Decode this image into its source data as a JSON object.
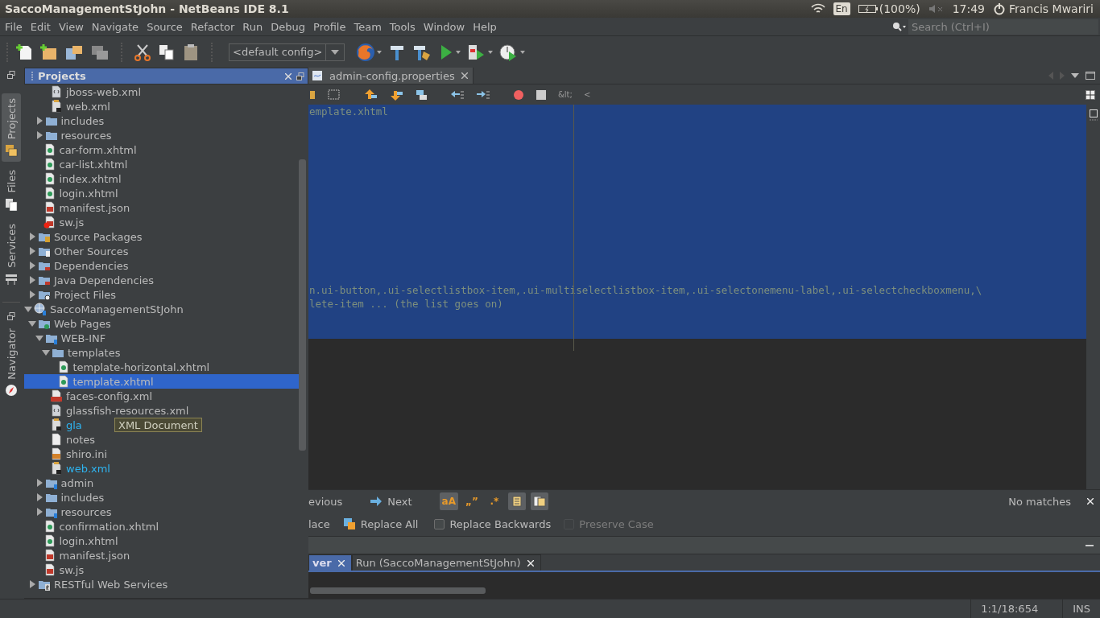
{
  "title_bar": {
    "title": "SaccoManagementStJohn - NetBeans IDE 8.1",
    "keyboard": "En",
    "battery": "(100%)",
    "time": "17:49",
    "user": "Francis Mwariri"
  },
  "menu": [
    "File",
    "Edit",
    "View",
    "Navigate",
    "Source",
    "Refactor",
    "Run",
    "Debug",
    "Profile",
    "Team",
    "Tools",
    "Window",
    "Help"
  ],
  "search": {
    "placeholder": "Search (Ctrl+I)"
  },
  "toolbar": {
    "config": "<default config>"
  },
  "side_tabs": [
    {
      "label": "Projects",
      "kind": "projects",
      "selected": true
    },
    {
      "label": "Files",
      "kind": "files",
      "selected": false
    },
    {
      "label": "Services",
      "kind": "services",
      "selected": false
    },
    {
      "label": "Navigator",
      "kind": "navigator",
      "selected": false
    }
  ],
  "projects_panel": {
    "title": "Projects",
    "tree": [
      {
        "children": [
          {
            "children": [
              {
                "children": [
                  {
                    "label": "jboss-web.xml",
                    "kind": "descriptor",
                    "selected": false,
                    "modified": false
                  },
                  {
                    "label": "web.xml",
                    "kind": "xml-doc",
                    "selected": false,
                    "modified": false
                  }
                ]
              },
              {
                "label": "includes",
                "kind": "folder",
                "expanded": false,
                "selected": false,
                "modified": false
              },
              {
                "label": "resources",
                "kind": "folder",
                "expanded": false,
                "selected": false,
                "modified": false
              },
              {
                "label": "car-form.xhtml",
                "kind": "xhtml",
                "selected": false,
                "modified": false
              },
              {
                "label": "car-list.xhtml",
                "kind": "xhtml",
                "selected": false,
                "modified": false
              },
              {
                "label": "index.xhtml",
                "kind": "xhtml",
                "selected": false,
                "modified": false
              },
              {
                "label": "login.xhtml",
                "kind": "xhtml",
                "selected": false,
                "modified": false
              },
              {
                "label": "manifest.json",
                "kind": "js",
                "selected": false,
                "modified": false
              },
              {
                "label": "sw.js",
                "kind": "js-error",
                "selected": false,
                "modified": false
              }
            ]
          },
          {
            "label": "Source Packages",
            "kind": "package-folder",
            "expanded": false,
            "selected": false,
            "modified": false
          },
          {
            "label": "Other Sources",
            "kind": "sources-folder",
            "expanded": false,
            "selected": false,
            "modified": false
          },
          {
            "label": "Dependencies",
            "kind": "lib-folder",
            "expanded": false,
            "selected": false,
            "modified": false
          },
          {
            "label": "Java Dependencies",
            "kind": "lib-folder",
            "expanded": false,
            "selected": false,
            "modified": false
          },
          {
            "label": "Project Files",
            "kind": "config-folder",
            "expanded": false,
            "selected": false,
            "modified": false
          }
        ]
      },
      {
        "label": "SaccoManagementStJohn",
        "kind": "web-project",
        "expanded": true,
        "selected": false,
        "modified": false,
        "children": [
          {
            "label": "Web Pages",
            "kind": "web-folder",
            "expanded": true,
            "selected": false,
            "modified": false,
            "children": [
              {
                "label": "WEB-INF",
                "kind": "folder-vcs",
                "expanded": true,
                "selected": false,
                "modified": false,
                "children": [
                  {
                    "label": "templates",
                    "kind": "folder",
                    "expanded": true,
                    "selected": false,
                    "modified": false,
                    "children": [
                      {
                        "label": "template-horizontal.xhtml",
                        "kind": "xhtml",
                        "selected": false,
                        "modified": false
                      },
                      {
                        "label": "template.xhtml",
                        "kind": "xhtml",
                        "selected": true,
                        "modified": false
                      }
                    ]
                  },
                  {
                    "label": "faces-config.xml",
                    "kind": "jsf",
                    "selected": false,
                    "modified": false
                  },
                  {
                    "label": "glassfish-resources.xml",
                    "kind": "descriptor",
                    "selected": false,
                    "modified": false
                  },
                  {
                    "label": "gla",
                    "kind": "xml-doc",
                    "selected": false,
                    "modified": true,
                    "tooltip": "XML Document"
                  },
                  {
                    "label": "notes",
                    "kind": "text",
                    "selected": false,
                    "modified": false
                  },
                  {
                    "label": "shiro.ini",
                    "kind": "ini",
                    "selected": false,
                    "modified": false
                  },
                  {
                    "label": "web.xml",
                    "kind": "xml-doc",
                    "selected": false,
                    "modified": true
                  }
                ]
              },
              {
                "label": "admin",
                "kind": "folder-vcs",
                "expanded": false,
                "selected": false,
                "modified": false
              },
              {
                "label": "includes",
                "kind": "folder",
                "expanded": false,
                "selected": false,
                "modified": false
              },
              {
                "label": "resources",
                "kind": "folder-vcs",
                "expanded": false,
                "selected": false,
                "modified": false
              },
              {
                "label": "confirmation.xhtml",
                "kind": "xhtml",
                "selected": false,
                "modified": false
              },
              {
                "label": "login.xhtml",
                "kind": "xhtml",
                "selected": false,
                "modified": false
              },
              {
                "label": "manifest.json",
                "kind": "js",
                "selected": false,
                "modified": false
              },
              {
                "label": "sw.js",
                "kind": "js",
                "selected": false,
                "modified": false
              }
            ]
          },
          {
            "label": "RESTful Web Services",
            "kind": "rest-folder",
            "expanded": false,
            "selected": false,
            "modified": false
          }
        ]
      }
    ]
  },
  "editor": {
    "tab": "admin-config.properties",
    "toolbar_texts": [
      "&lt;",
      "<"
    ],
    "selection": true,
    "lines_top": [
      "emplate.xhtml"
    ],
    "lines_bottom": [
      "n.ui-button,.ui-selectlistbox-item,.ui-multiselectlistbox-item,.ui-selectonemenu-label,.ui-selectcheckboxmenu,\\",
      "lete-item ... (the list goes on)"
    ]
  },
  "find_bar": {
    "previous": "evious",
    "next": "Next",
    "toggles": [
      {
        "label": "aA",
        "selected": true
      },
      {
        "label": "„”",
        "selected": false
      },
      {
        "label": ".*",
        "selected": false
      },
      {
        "kind": "highlight",
        "selected": true
      },
      {
        "kind": "wrap",
        "selected": true
      }
    ],
    "status": "No matches",
    "replace": "lace",
    "replace_all": "Replace All",
    "options": [
      {
        "label": "Replace Backwards",
        "checked": false,
        "disabled": false
      },
      {
        "label": "Preserve Case",
        "checked": false,
        "disabled": true
      }
    ]
  },
  "output": {
    "tabs": [
      {
        "label": "ver",
        "selected": true
      },
      {
        "label": "Run (SaccoManagementStJohn)",
        "selected": false
      }
    ]
  },
  "status_bar": {
    "position": "1:1/18:654",
    "mode": "INS"
  }
}
